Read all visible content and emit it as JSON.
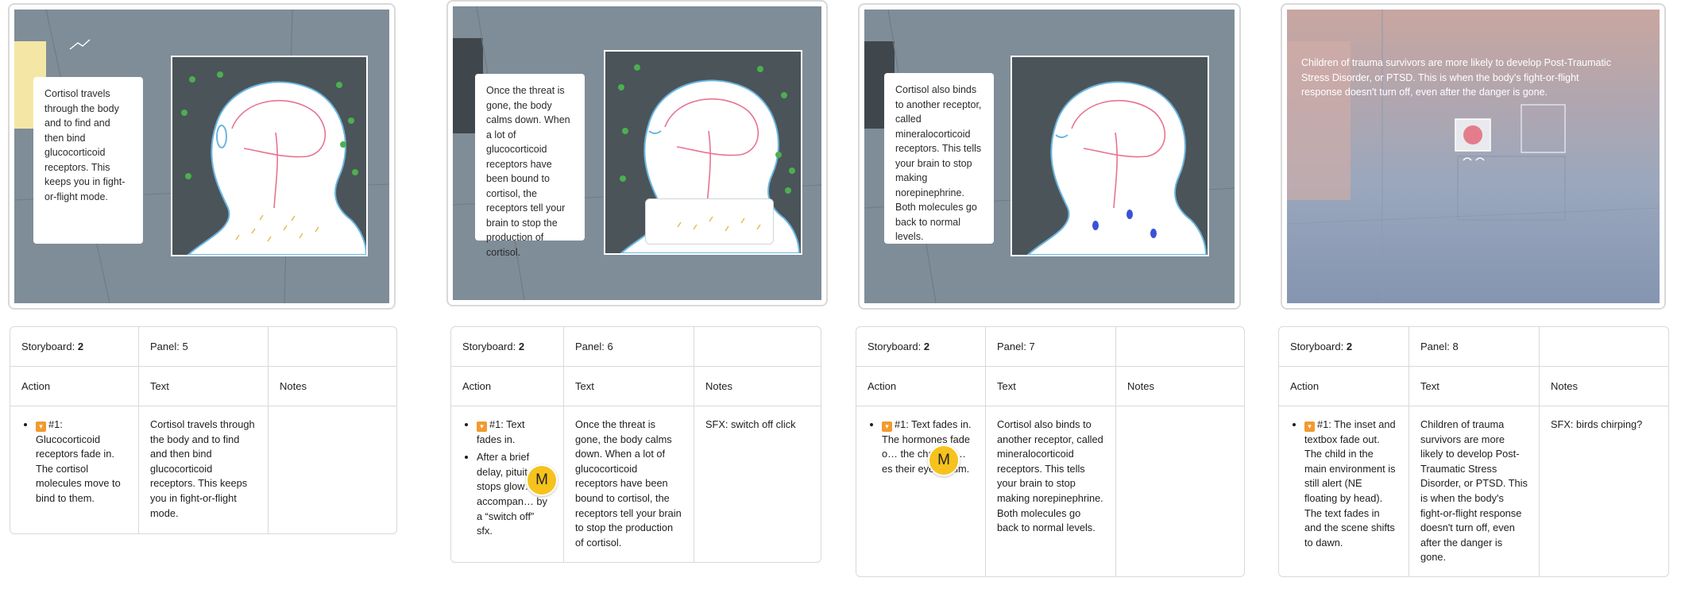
{
  "boards": [
    {
      "storyboard_label": "Storyboard:",
      "storyboard_num": "2",
      "panel": "Panel: 5",
      "caption": "Cortisol travels through the body and to find and then bind glucocorticoid receptors. This keeps you in fight-or-flight mode.",
      "action_header": "Action",
      "text_header": "Text",
      "notes_header": "Notes",
      "action_items": [
        "#1: Glucocorticoid receptors fade in. The cortisol molecules move to bind to them."
      ],
      "text": "Cortisol travels through the body and to find and then bind glucocorticoid receptors. This keeps you in fight-or-flight mode.",
      "notes": ""
    },
    {
      "storyboard_label": "Storyboard:",
      "storyboard_num": "2",
      "panel": "Panel: 6",
      "caption": "Once the threat is gone, the body calms down. When a lot of glucocorticoid receptors have been bound to cortisol, the receptors tell your brain to stop the production of cortisol.",
      "action_header": "Action",
      "text_header": "Text",
      "notes_header": "Notes",
      "action_items": [
        "#1: Text fades in.",
        "After a brief delay, pituit… stops glow… accompan… by a “switch off” sfx."
      ],
      "text": "Once the threat is gone, the body calms down. When a lot of glucocorticoid receptors have been bound to cortisol, the receptors tell your brain to stop the production of cortisol.",
      "notes": "SFX: switch off click",
      "avatar": "M"
    },
    {
      "storyboard_label": "Storyboard:",
      "storyboard_num": "2",
      "panel": "Panel: 7",
      "caption": "Cortisol also binds to another receptor, called mineralocorticoid receptors. This tells your brain to stop making norepinephrine. Both molecules go back to normal levels.",
      "action_header": "Action",
      "text_header": "Text",
      "notes_header": "Notes",
      "action_items": [
        "#1: Text fades in. The hormones fade o… the chara… …es their eyes, calm."
      ],
      "text": "Cortisol also binds to another receptor, called mineralocorticoid receptors. This tells your brain to stop making norepinephrine. Both molecules go back to normal levels.",
      "notes": "",
      "avatar": "M"
    },
    {
      "storyboard_label": "Storyboard:",
      "storyboard_num": "2",
      "panel": "Panel: 8",
      "caption": "Children of trauma survivors are more likely to develop Post-Traumatic Stress Disorder, or PTSD. This is when the body's fight-or-flight response doesn't turn off, even after the danger is gone.",
      "action_header": "Action",
      "text_header": "Text",
      "notes_header": "Notes",
      "action_items": [
        "#1: The inset and textbox fade out. The child in the main environment is still alert (NE floating by head). The text fades in and the scene shifts to dawn."
      ],
      "text": "Children of trauma survivors are more likely to develop Post-Traumatic Stress Disorder, or PTSD. This is when the body's fight-or-flight response doesn't turn off, even after the danger is gone.",
      "notes": "SFX: birds chirping?"
    }
  ],
  "colors": {
    "scene": "#7f8d98",
    "inset_bg": "#4b5459",
    "brain_line": "#e8738f",
    "outline": "#6ab6e0",
    "receptor": "#4caf50",
    "avatar": "#f6c21c",
    "action_tag": "#f29a2e"
  }
}
